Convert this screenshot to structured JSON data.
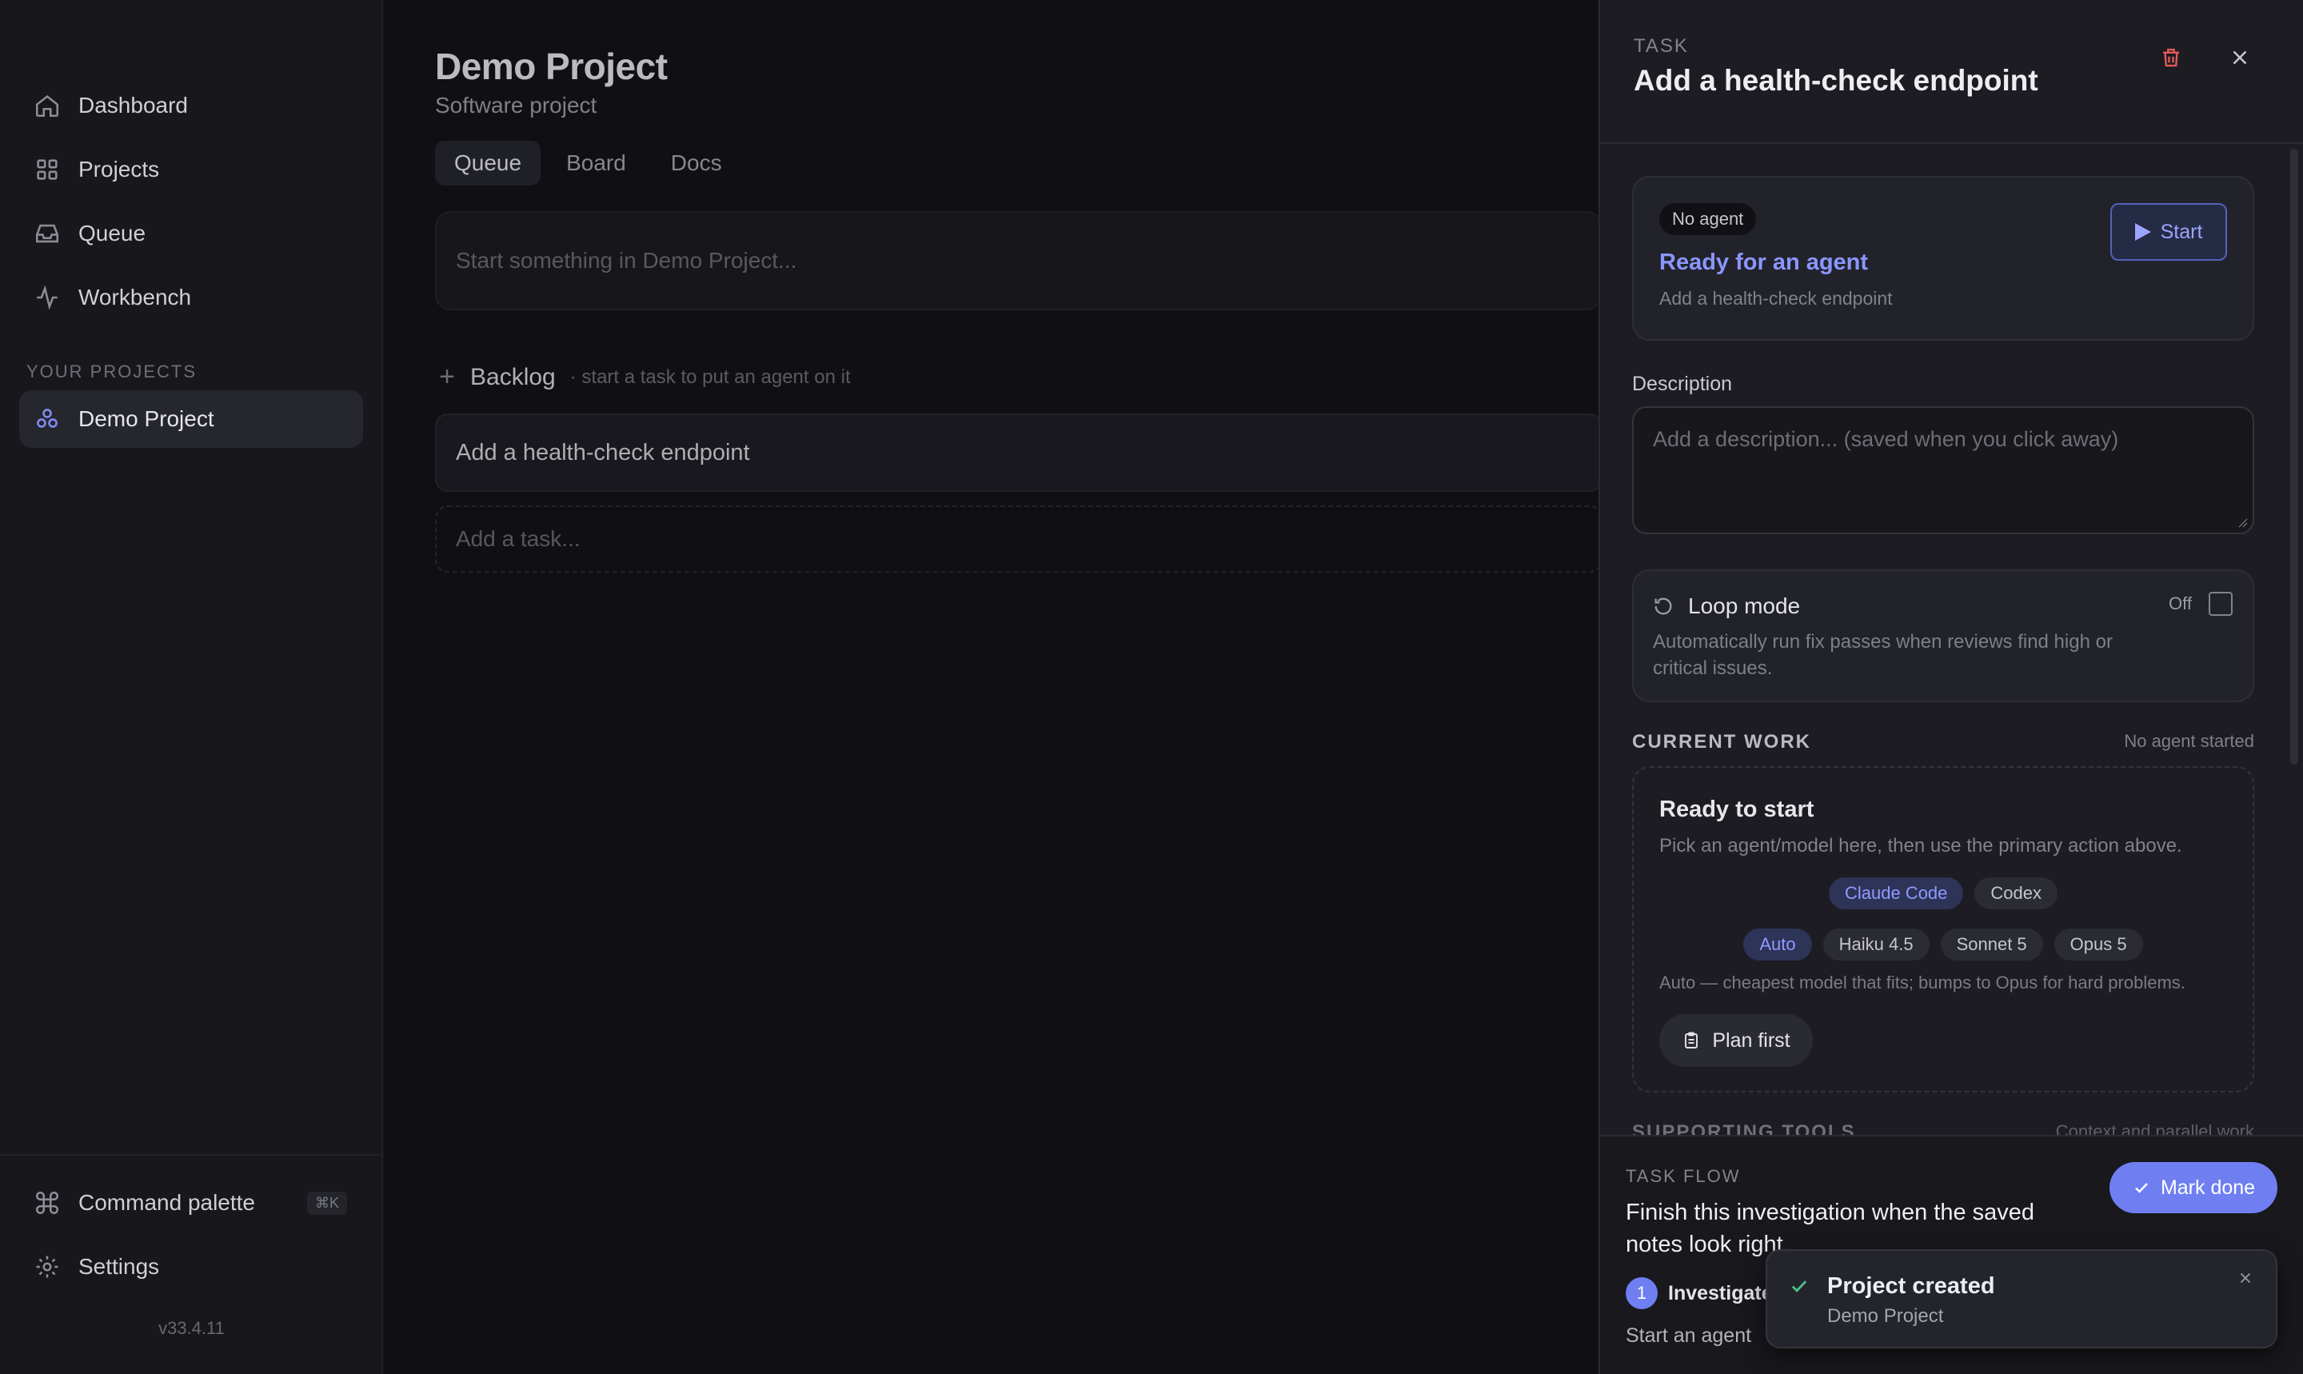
{
  "sidebar": {
    "nav": [
      {
        "label": "Dashboard",
        "icon": "home-icon"
      },
      {
        "label": "Projects",
        "icon": "grid-icon"
      },
      {
        "label": "Queue",
        "icon": "inbox-icon"
      },
      {
        "label": "Workbench",
        "icon": "activity-icon"
      }
    ],
    "section_label": "YOUR PROJECTS",
    "projects": [
      {
        "label": "Demo Project",
        "icon": "project-icon"
      }
    ],
    "footer": {
      "command_palette": "Command palette",
      "command_shortcut": "⌘K",
      "settings": "Settings",
      "version": "v33.4.11"
    }
  },
  "main": {
    "title": "Demo Project",
    "subtitle": "Software project",
    "tabs": [
      {
        "label": "Queue",
        "active": true
      },
      {
        "label": "Board",
        "active": false
      },
      {
        "label": "Docs",
        "active": false
      }
    ],
    "compose_placeholder": "Start something in Demo Project...",
    "backlog": {
      "title": "Backlog",
      "hint": "· start a task to put an agent on it",
      "tasks": [
        "Add a health-check endpoint"
      ],
      "add_placeholder": "Add a task..."
    }
  },
  "panel": {
    "kicker": "TASK",
    "title": "Add a health-check endpoint",
    "status_card": {
      "badge": "No agent",
      "title": "Ready for an agent",
      "subtitle": "Add a health-check endpoint",
      "start_label": "Start"
    },
    "description": {
      "label": "Description",
      "placeholder": "Add a description... (saved when you click away)"
    },
    "loop": {
      "title": "Loop mode",
      "description": "Automatically run fix passes when reviews find high or critical issues.",
      "state_label": "Off"
    },
    "current_work": {
      "title": "CURRENT WORK",
      "status": "No agent started",
      "card_title": "Ready to start",
      "card_sub": "Pick an agent/model here, then use the primary action above.",
      "agents": [
        {
          "label": "Claude Code",
          "selected": true
        },
        {
          "label": "Codex",
          "selected": false
        }
      ],
      "models": [
        {
          "label": "Auto",
          "selected": true
        },
        {
          "label": "Haiku 4.5",
          "selected": false
        },
        {
          "label": "Sonnet 5",
          "selected": false
        },
        {
          "label": "Opus 5",
          "selected": false
        }
      ],
      "auto_note": "Auto — cheapest model that fits; bumps to Opus for hard problems.",
      "plan_label": "Plan first"
    },
    "supporting": {
      "title": "SUPPORTING TOOLS",
      "right": "Context and parallel work"
    },
    "flow": {
      "kicker": "TASK FLOW",
      "text": "Finish this investigation when the saved notes look right.",
      "done_label": "Mark done",
      "step_number": "1",
      "step_label": "Investigate",
      "step_sub": "Start an agent"
    },
    "toast": {
      "title": "Project created",
      "subtitle": "Demo Project"
    }
  },
  "colors": {
    "accent": "#6f7ff1",
    "background": "#141419",
    "panel": "#1c1c22"
  }
}
